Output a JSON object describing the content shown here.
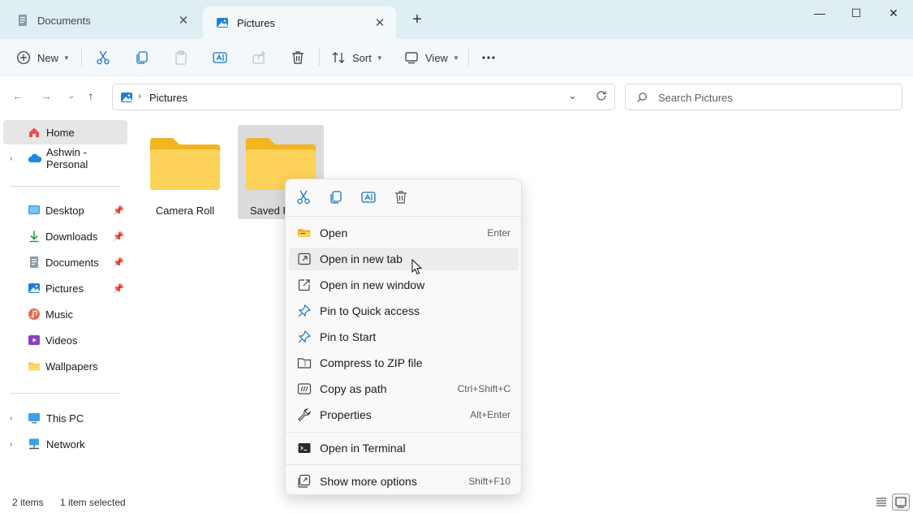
{
  "tabs": [
    {
      "label": "Documents",
      "icon": "documents-icon"
    },
    {
      "label": "Pictures",
      "icon": "pictures-icon"
    }
  ],
  "window_controls": {
    "minimize": "—",
    "maximize": "☐",
    "close": "✕"
  },
  "toolbar": {
    "new_label": "New",
    "sort_label": "Sort",
    "view_label": "View"
  },
  "address": {
    "path": "Pictures",
    "search_placeholder": "Search Pictures"
  },
  "sidebar": {
    "home": "Home",
    "onedrive": "Ashwin - Personal",
    "quick": [
      {
        "label": "Desktop",
        "pinned": true
      },
      {
        "label": "Downloads",
        "pinned": true
      },
      {
        "label": "Documents",
        "pinned": true
      },
      {
        "label": "Pictures",
        "pinned": true
      },
      {
        "label": "Music",
        "pinned": false
      },
      {
        "label": "Videos",
        "pinned": false
      },
      {
        "label": "Wallpapers",
        "pinned": false
      }
    ],
    "this_pc": "This PC",
    "network": "Network"
  },
  "folders": [
    {
      "label": "Camera Roll",
      "selected": false
    },
    {
      "label": "Saved P",
      "selected": true
    }
  ],
  "status": {
    "items": "2 items",
    "selected": "1 item selected"
  },
  "context_menu": {
    "quick_actions": [
      "cut-icon",
      "copy-icon",
      "rename-icon",
      "delete-icon"
    ],
    "items": [
      {
        "label": "Open",
        "shortcut": "Enter",
        "icon": "folder-open-icon"
      },
      {
        "label": "Open in new tab",
        "shortcut": "",
        "icon": "new-tab-icon"
      },
      {
        "label": "Open in new window",
        "shortcut": "",
        "icon": "new-window-icon"
      },
      {
        "label": "Pin to Quick access",
        "shortcut": "",
        "icon": "pin-icon"
      },
      {
        "label": "Pin to Start",
        "shortcut": "",
        "icon": "pin-icon"
      },
      {
        "label": "Compress to ZIP file",
        "shortcut": "",
        "icon": "zip-icon"
      },
      {
        "label": "Copy as path",
        "shortcut": "Ctrl+Shift+C",
        "icon": "copy-path-icon"
      },
      {
        "label": "Properties",
        "shortcut": "Alt+Enter",
        "icon": "properties-icon"
      },
      {
        "label": "Open in Terminal",
        "shortcut": "",
        "icon": "terminal-icon"
      },
      {
        "label": "Show more options",
        "shortcut": "Shift+F10",
        "icon": "more-options-icon"
      }
    ]
  },
  "colors": {
    "accent": "#0067c0",
    "folder": "#f8c93e",
    "titlebar": "#dfeef2"
  }
}
